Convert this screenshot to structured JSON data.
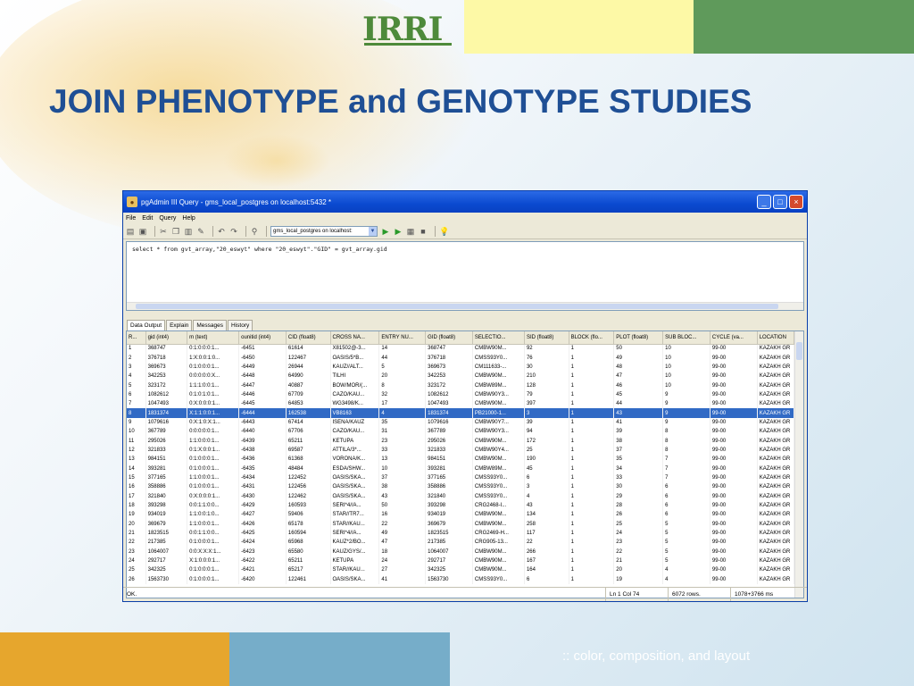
{
  "slide": {
    "logo": "IRRI",
    "title": "JOIN PHENOTYPE and GENOTYPE STUDIES",
    "footer": "::  color, composition, and layout",
    "colors": {
      "title": "#1f4f95",
      "logo": "#4e8a3a",
      "yellow": "#fdf9a6",
      "green": "#5f9a5b",
      "orange": "#e6a62d",
      "blue": "#76adc9"
    }
  },
  "window": {
    "title": "pgAdmin III Query - gms_local_postgres on localhost:5432 *",
    "menu": [
      "File",
      "Edit",
      "Query",
      "Help"
    ],
    "toolbar": {
      "connection": "gms_local_postgres on localhost:"
    },
    "sql": "select * from gvt_array,\"20_eswyt\" where \"20_eswyt\".\"GID\" = gvt_array.gid",
    "tabs": [
      "Data Output",
      "Explain",
      "Messages",
      "History"
    ],
    "columns": [
      "R...",
      "gid (int4)",
      "m (text)",
      "ounitid (int4)",
      "CID (float8)",
      "CROSS NA...",
      "ENTRY NU...",
      "GID (float8)",
      "SELECTIO...",
      "SID (float8)",
      "BLOCK (flo...",
      "PLOT (float8)",
      "SUB BLOC...",
      "CYCLE (va...",
      "LOCATION"
    ],
    "rows": [
      [
        "1",
        "368747",
        "0:1:0:0:0:1...",
        "-6451",
        "61614",
        "X81502@-3...",
        "14",
        "368747",
        "CMBW90M...",
        "92",
        "1",
        "50",
        "10",
        "99-00",
        "KAZAKH GR"
      ],
      [
        "2",
        "376718",
        "1:X:0:0:1:0...",
        "-6450",
        "122467",
        "OASIS/5*B...",
        "44",
        "376718",
        "CMSS93Y0...",
        "76",
        "1",
        "49",
        "10",
        "99-00",
        "KAZAKH GR"
      ],
      [
        "3",
        "369673",
        "0:1:0:0:0:1...",
        "-6449",
        "26944",
        "KAUZ//ALT...",
        "5",
        "369673",
        "CM111633-...",
        "30",
        "1",
        "48",
        "10",
        "99-00",
        "KAZAKH GR"
      ],
      [
        "4",
        "342253",
        "0:0:0:0:0:X...",
        "-6448",
        "64990",
        "TILHI",
        "20",
        "342253",
        "CMBW90M...",
        "210",
        "1",
        "47",
        "10",
        "99-00",
        "KAZAKH GR"
      ],
      [
        "5",
        "323172",
        "1:1:1:0:0:1...",
        "-6447",
        "40887",
        "BOW/MOR/(...",
        "8",
        "323172",
        "CMBW89M...",
        "128",
        "1",
        "46",
        "10",
        "99-00",
        "KAZAKH GR"
      ],
      [
        "6",
        "1082612",
        "0:1:0:1:0:1...",
        "-6446",
        "67709",
        "CAZO/KAU...",
        "32",
        "1082612",
        "CMBW90Y3...",
        "79",
        "1",
        "45",
        "9",
        "99-00",
        "KAZAKH GR"
      ],
      [
        "7",
        "1047493",
        "0:X:0:0:0:1...",
        "-6445",
        "64853",
        "WG3498/K...",
        "17",
        "1047493",
        "CMBW90M...",
        "397",
        "1",
        "44",
        "9",
        "99-00",
        "KAZAKH GR"
      ],
      [
        "8",
        "1831374",
        "X:1:1:0:0:1...",
        "-6444",
        "162538",
        "VB8163",
        "4",
        "1831374",
        "PB21000-1...",
        "3",
        "1",
        "43",
        "9",
        "99-00",
        "KAZAKH GR"
      ],
      [
        "9",
        "1079616",
        "0:X:1:0:X:1...",
        "-6443",
        "67414",
        "ISENA/KAUZ",
        "35",
        "1079616",
        "CMBW90Y7...",
        "39",
        "1",
        "41",
        "9",
        "99-00",
        "KAZAKH GR"
      ],
      [
        "10",
        "367789",
        "0:0:0:0:0:1...",
        "-6440",
        "67706",
        "CAZO/KAU...",
        "31",
        "367789",
        "CMBW90Y3...",
        "94",
        "1",
        "39",
        "8",
        "99-00",
        "KAZAKH GR"
      ],
      [
        "11",
        "295026",
        "1:1:0:0:0:1...",
        "-6439",
        "65211",
        "KETUPA",
        "23",
        "295026",
        "CMBW90M...",
        "172",
        "1",
        "38",
        "8",
        "99-00",
        "KAZAKH GR"
      ],
      [
        "12",
        "321833",
        "0:1:X:0:0:1...",
        "-6438",
        "69587",
        "ATTILA/3*...",
        "33",
        "321833",
        "CMBW90Y4...",
        "25",
        "1",
        "37",
        "8",
        "99-00",
        "KAZAKH GR"
      ],
      [
        "13",
        "984151",
        "0:1:0:0:0:1...",
        "-6436",
        "61368",
        "VORONA/K...",
        "13",
        "984151",
        "CMBW90M...",
        "190",
        "1",
        "35",
        "7",
        "99-00",
        "KAZAKH GR"
      ],
      [
        "14",
        "393281",
        "0:1:0:0:0:1...",
        "-6435",
        "48484",
        "ESDA/SHW...",
        "10",
        "393281",
        "CMBW89M...",
        "45",
        "1",
        "34",
        "7",
        "99-00",
        "KAZAKH GR"
      ],
      [
        "15",
        "377165",
        "1:1:0:0:0:1...",
        "-6434",
        "122452",
        "OASIS/SKA...",
        "37",
        "377165",
        "CMSS93Y0...",
        "6",
        "1",
        "33",
        "7",
        "99-00",
        "KAZAKH GR"
      ],
      [
        "16",
        "358886",
        "0:1:0:0:0:1...",
        "-6431",
        "122456",
        "OASIS/SKA...",
        "38",
        "358886",
        "CMSS93Y0...",
        "3",
        "1",
        "30",
        "6",
        "99-00",
        "KAZAKH GR"
      ],
      [
        "17",
        "321840",
        "0:X:0:0:0:1...",
        "-6430",
        "122462",
        "OASIS/SKA...",
        "43",
        "321840",
        "CMSS93Y0...",
        "4",
        "1",
        "29",
        "6",
        "99-00",
        "KAZAKH GR"
      ],
      [
        "18",
        "393298",
        "0:0:1:1:0:0...",
        "-6429",
        "160593",
        "SERI*4//A...",
        "50",
        "393298",
        "CRG2468-I...",
        "43",
        "1",
        "28",
        "6",
        "99-00",
        "KAZAKH GR"
      ],
      [
        "19",
        "934019",
        "1:1:0:0:1:0...",
        "-6427",
        "59406",
        "STAR//TR7...",
        "16",
        "934019",
        "CMBW90M...",
        "134",
        "1",
        "26",
        "6",
        "99-00",
        "KAZAKH GR"
      ],
      [
        "20",
        "369679",
        "1:1:0:0:0:1...",
        "-6426",
        "65178",
        "STAR//KAU...",
        "22",
        "369679",
        "CMBW90M...",
        "258",
        "1",
        "25",
        "5",
        "99-00",
        "KAZAKH GR"
      ],
      [
        "21",
        "1823515",
        "0:0:1:1:0:0...",
        "-6425",
        "160594",
        "SERI*4//A...",
        "49",
        "1823515",
        "CRG2469-H...",
        "117",
        "1",
        "24",
        "5",
        "99-00",
        "KAZAKH GR"
      ],
      [
        "22",
        "217385",
        "0:1:0:0:0:1...",
        "-6424",
        "65968",
        "KAUZ*2/BO...",
        "47",
        "217385",
        "CRG905-13...",
        "22",
        "1",
        "23",
        "5",
        "99-00",
        "KAZAKH GR"
      ],
      [
        "23",
        "1064007",
        "0:0:X:X:X:1...",
        "-6423",
        "65580",
        "KAUZ/GYS/...",
        "18",
        "1064007",
        "CMBW90M...",
        "266",
        "1",
        "22",
        "5",
        "99-00",
        "KAZAKH GR"
      ],
      [
        "24",
        "292717",
        "X:1:0:0:0:1...",
        "-6422",
        "65211",
        "KETUPA",
        "24",
        "292717",
        "CMBW90M...",
        "167",
        "1",
        "21",
        "5",
        "99-00",
        "KAZAKH GR"
      ],
      [
        "25",
        "342325",
        "0:1:0:0:0:1...",
        "-6421",
        "65217",
        "STAR//KAU...",
        "27",
        "342325",
        "CMBW90M...",
        "164",
        "1",
        "20",
        "4",
        "99-00",
        "KAZAKH GR"
      ],
      [
        "26",
        "1563730",
        "0:1:0:0:0:1...",
        "-6420",
        "122461",
        "OASIS/SKA...",
        "41",
        "1563730",
        "CMSS93Y0...",
        "6",
        "1",
        "19",
        "4",
        "99-00",
        "KAZAKH GR"
      ]
    ],
    "selected_row": 7,
    "status": {
      "message": "OK.",
      "position": "Ln 1 Col 74",
      "rows": "6072 rows.",
      "time": "1078+3766 ms"
    }
  }
}
